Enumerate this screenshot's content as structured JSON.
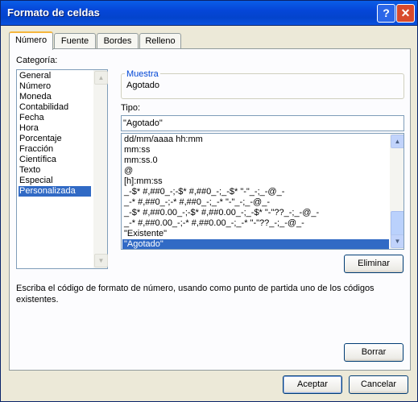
{
  "window": {
    "title": "Formato de celdas",
    "help_glyph": "?",
    "close_glyph": "✕"
  },
  "tabs": [
    {
      "label": "Número",
      "active": true
    },
    {
      "label": "Fuente",
      "active": false
    },
    {
      "label": "Bordes",
      "active": false
    },
    {
      "label": "Relleno",
      "active": false
    }
  ],
  "categoria": {
    "label": "Categoría:",
    "items": [
      "General",
      "Número",
      "Moneda",
      "Contabilidad",
      "Fecha",
      "Hora",
      "Porcentaje",
      "Fracción",
      "Científica",
      "Texto",
      "Especial",
      "Personalizada"
    ],
    "selected": "Personalizada"
  },
  "muestra": {
    "title": "Muestra",
    "value": "Agotado"
  },
  "tipo": {
    "label": "Tipo:",
    "value": "\"Agotado\"",
    "items": [
      "dd/mm/aaaa hh:mm",
      "mm:ss",
      "mm:ss.0",
      "@",
      "[h]:mm:ss",
      "_-$* #,##0_-;-$* #,##0_-;_-$* \"-\"_-;_-@_-",
      "_-* #,##0_-;-* #,##0_-;_-* \"-\"_-;_-@_-",
      "_-$* #,##0.00_-;-$* #,##0.00_-;_-$* \"-\"??_-;_-@_-",
      "_-* #,##0.00_-;-* #,##0.00_-;_-* \"-\"??_-;_-@_-",
      "\"Existente\"",
      "\"Agotado\""
    ],
    "selected": "\"Agotado\""
  },
  "buttons": {
    "eliminar": "Eliminar",
    "borrar": "Borrar",
    "aceptar": "Aceptar",
    "cancelar": "Cancelar"
  },
  "description": "Escriba el código de formato de número, usando como punto de partida uno de los códigos existentes.",
  "colors": {
    "title_bar": "#0546d8",
    "selection": "#316ac5",
    "active_tab_accent": "#f5b63d",
    "group_title": "#0046d5"
  }
}
